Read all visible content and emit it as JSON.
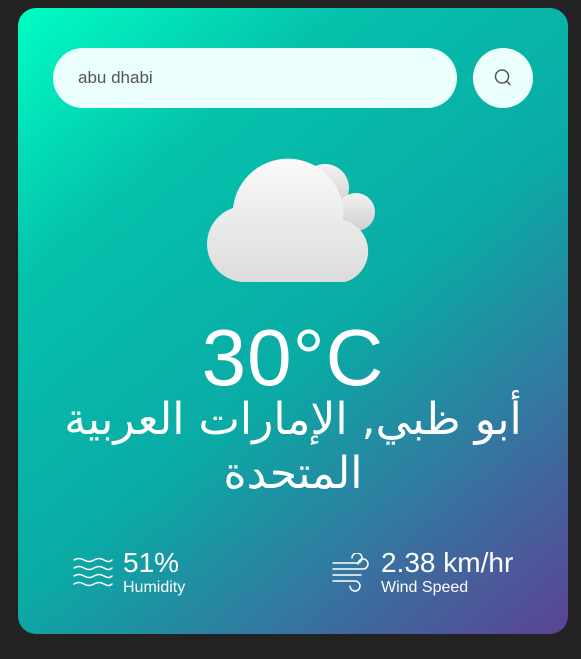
{
  "search": {
    "value": "abu dhabi"
  },
  "weather": {
    "temperature": "30°C",
    "city": "أبو ظبي, الإمارات العربية المتحدة",
    "condition_icon": "cloud-icon"
  },
  "details": {
    "humidity": {
      "value": "51%",
      "label": "Humidity",
      "icon": "humidity-icon"
    },
    "wind": {
      "value": "2.38 km/hr",
      "label": "Wind Speed",
      "icon": "wind-icon"
    }
  },
  "colors": {
    "gradient_start": "#00fec4",
    "gradient_end": "#5b4293",
    "input_bg": "#ebfffc",
    "page_bg": "#222222"
  }
}
